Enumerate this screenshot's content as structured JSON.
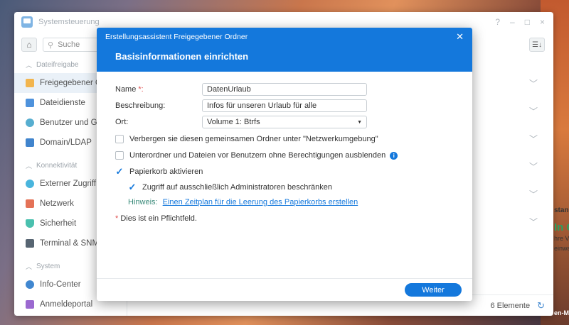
{
  "window": {
    "title": "Systemsteuerung",
    "controls": [
      "?",
      "–",
      "□",
      "×"
    ]
  },
  "toolbar": {
    "search_placeholder": "Suche",
    "sort_icon": "sort-list-icon"
  },
  "sidebar": {
    "sections": [
      {
        "label": "Dateifreigabe",
        "items": [
          {
            "label": "Freigegebener Ordner",
            "icon": "folder-icon",
            "color": "#f0a830",
            "active": true
          },
          {
            "label": "Dateidienste",
            "icon": "file-services-icon",
            "color": "#2f7fd6"
          },
          {
            "label": "Benutzer und Gruppe",
            "icon": "users-icon",
            "color": "#3aa0c8"
          },
          {
            "label": "Domain/LDAP",
            "icon": "domain-icon",
            "color": "#1f6fc5"
          }
        ]
      },
      {
        "label": "Konnektivität",
        "items": [
          {
            "label": "Externer Zugriff",
            "icon": "external-access-icon",
            "color": "#2aa8d8"
          },
          {
            "label": "Netzwerk",
            "icon": "network-icon",
            "color": "#e05a3a"
          },
          {
            "label": "Sicherheit",
            "icon": "shield-icon",
            "color": "#2bb5a0"
          },
          {
            "label": "Terminal & SNMP",
            "icon": "terminal-icon",
            "color": "#3a4a5a"
          }
        ]
      },
      {
        "label": "System",
        "items": [
          {
            "label": "Info-Center",
            "icon": "info-icon",
            "color": "#1f73c8"
          },
          {
            "label": "Anmeldeportal",
            "icon": "portal-icon",
            "color": "#8a4fc8"
          }
        ]
      }
    ]
  },
  "statusbar": {
    "count": "6 Elemente"
  },
  "right_peek": {
    "lines": [
      "stan",
      "In G",
      "hre V",
      "einwa",
      "en-M"
    ]
  },
  "modal": {
    "title": "Erstellungsassistent Freigegebener Ordner",
    "heading": "Basisinformationen einrichten",
    "fields": {
      "name_label": "Name",
      "name_req": "*:",
      "name_value": "DatenUrlaub",
      "desc_label": "Beschreibung:",
      "desc_value": "Infos für unseren Urlaub für alle",
      "ort_label": "Ort:",
      "ort_value": "Volume 1:  Btrfs"
    },
    "checkboxes": [
      {
        "label": "Verbergen sie diesen gemeinsamen Ordner unter \"Netzwerkumgebung\"",
        "checked": false
      },
      {
        "label": "Unterordner und Dateien vor Benutzern ohne Berechtigungen ausblenden",
        "checked": false,
        "info": true
      },
      {
        "label": "Papierkorb aktivieren",
        "checked": true
      },
      {
        "label": "Zugriff auf ausschließlich Administratoren beschränken",
        "checked": true
      }
    ],
    "hint_label": "Hinweis:",
    "hint_link": "Einen Zeitplan für die Leerung des Papierkorbs erstellen",
    "required_star": "*",
    "required_note": "Dies ist ein Pflichtfeld.",
    "next_button": "Weiter",
    "accent": "#1478dc"
  }
}
